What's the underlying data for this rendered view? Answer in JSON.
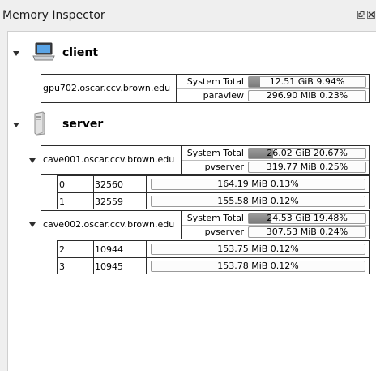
{
  "window": {
    "title": "Memory Inspector"
  },
  "icons": {
    "float": "float-icon",
    "close": "close-icon",
    "laptop": "laptop-icon",
    "tower": "tower-icon"
  },
  "client": {
    "name": "client",
    "host": "gpu702.oscar.ccv.brown.edu",
    "system_label": "System Total",
    "system_value": "12.51 GiB 9.94%",
    "system_percent": 9.94,
    "proc_label": "paraview",
    "proc_value": "296.90 MiB 0.23%",
    "proc_percent": 0.23
  },
  "server": {
    "name": "server",
    "nodes": [
      {
        "host": "cave001.oscar.ccv.brown.edu",
        "system_label": "System Total",
        "system_value": "26.02 GiB 20.67%",
        "system_percent": 20.67,
        "proc_label": "pvserver",
        "proc_value": "319.77 MiB 0.25%",
        "proc_percent": 0.25,
        "ranks": [
          {
            "rank": "0",
            "pid": "32560",
            "value": "164.19 MiB 0.13%",
            "percent": 0.13
          },
          {
            "rank": "1",
            "pid": "32559",
            "value": "155.58 MiB 0.12%",
            "percent": 0.12
          }
        ]
      },
      {
        "host": "cave002.oscar.ccv.brown.edu",
        "system_label": "System Total",
        "system_value": "24.53 GiB 19.48%",
        "system_percent": 19.48,
        "proc_label": "pvserver",
        "proc_value": "307.53 MiB 0.24%",
        "proc_percent": 0.24,
        "ranks": [
          {
            "rank": "2",
            "pid": "10944",
            "value": "153.75 MiB 0.12%",
            "percent": 0.12
          },
          {
            "rank": "3",
            "pid": "10945",
            "value": "153.78 MiB 0.12%",
            "percent": 0.12
          }
        ]
      }
    ]
  }
}
